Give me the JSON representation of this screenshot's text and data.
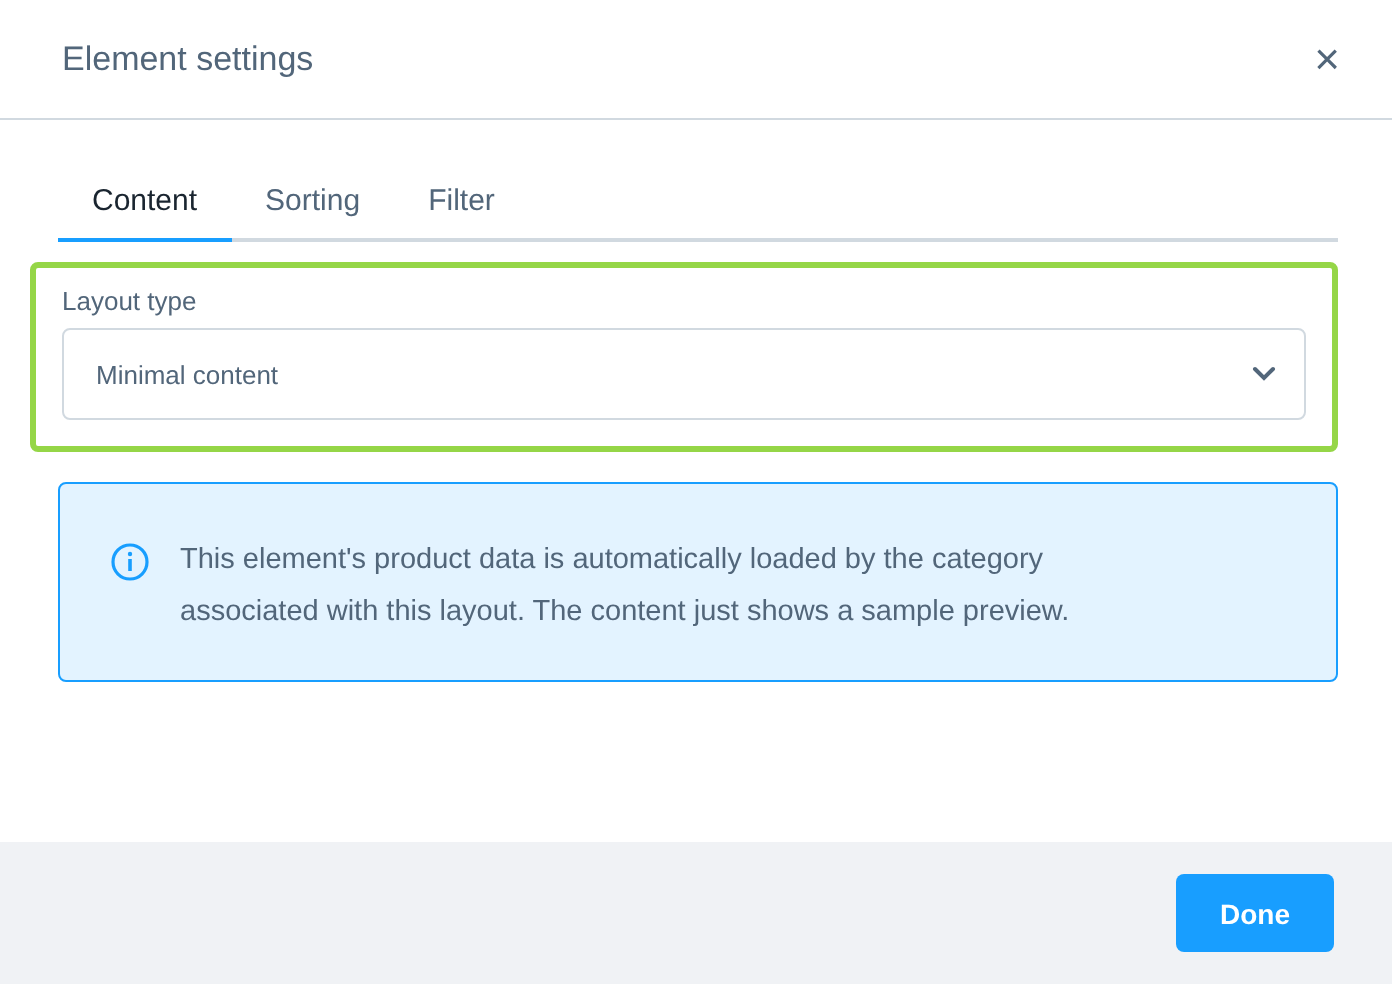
{
  "dialog": {
    "title": "Element settings",
    "close": "×"
  },
  "tabs": [
    {
      "label": "Content",
      "selected": true
    },
    {
      "label": "Sorting",
      "selected": false
    },
    {
      "label": "Filter",
      "selected": false
    }
  ],
  "layout_field": {
    "label": "Layout type",
    "value": "Minimal content",
    "highlighted": true
  },
  "info": {
    "text": "This element's product data is automatically loaded by the category associated with this layout. The content just shows a sample preview."
  },
  "buttons": [
    {
      "label": "Done"
    }
  ]
}
